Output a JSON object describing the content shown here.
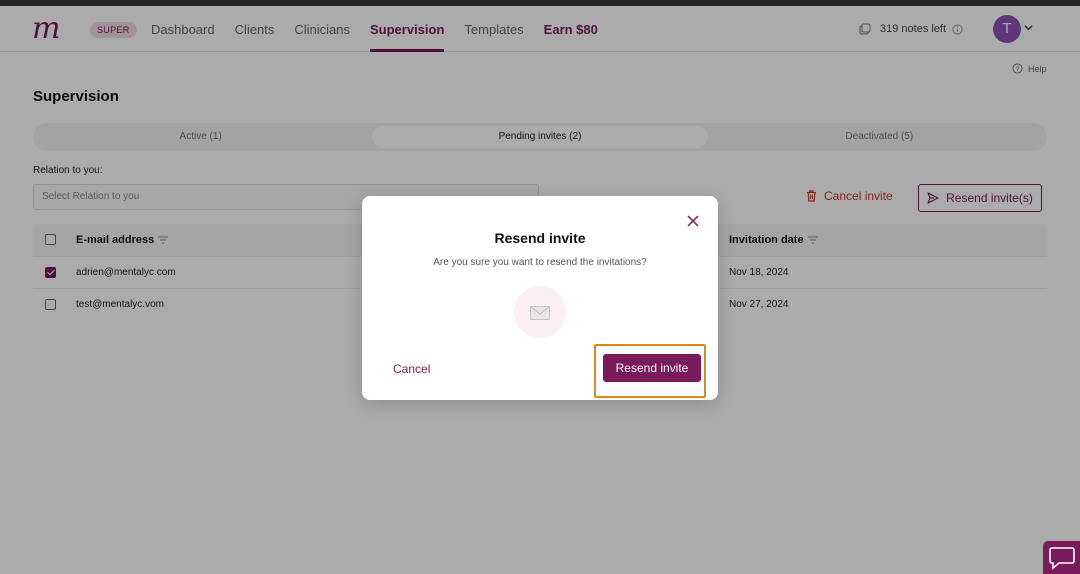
{
  "header": {
    "logo": "m",
    "badge": "SUPER",
    "nav": [
      "Dashboard",
      "Clients",
      "Clinicians",
      "Supervision",
      "Templates",
      "Earn $80"
    ],
    "notes_left": "319 notes left",
    "avatar_initial": "T"
  },
  "help": "Help",
  "page_title": "Supervision",
  "tabs": [
    "Active (1)",
    "Pending invites (2)",
    "Deactivated (5)"
  ],
  "relation": {
    "label": "Relation to you:",
    "placeholder": "Select Relation to you"
  },
  "actions": {
    "cancel_invite": "Cancel invite",
    "resend_invites": "Resend invite(s)"
  },
  "table": {
    "columns": [
      "E-mail address",
      "Invitation date"
    ],
    "rows": [
      {
        "email": "adrien@mentalyc.com",
        "date": "Nov 18, 2024",
        "checked": true
      },
      {
        "email": "test@mentalyc.vom",
        "date": "Nov 27, 2024",
        "checked": false
      }
    ]
  },
  "modal": {
    "title": "Resend invite",
    "message": "Are you sure you want to resend the invitations?",
    "cancel": "Cancel",
    "confirm": "Resend invite",
    "icon": "envelope-icon"
  },
  "colors": {
    "brand": "#7b1a5a",
    "danger": "#c0392b",
    "highlight": "#d98c1a"
  }
}
